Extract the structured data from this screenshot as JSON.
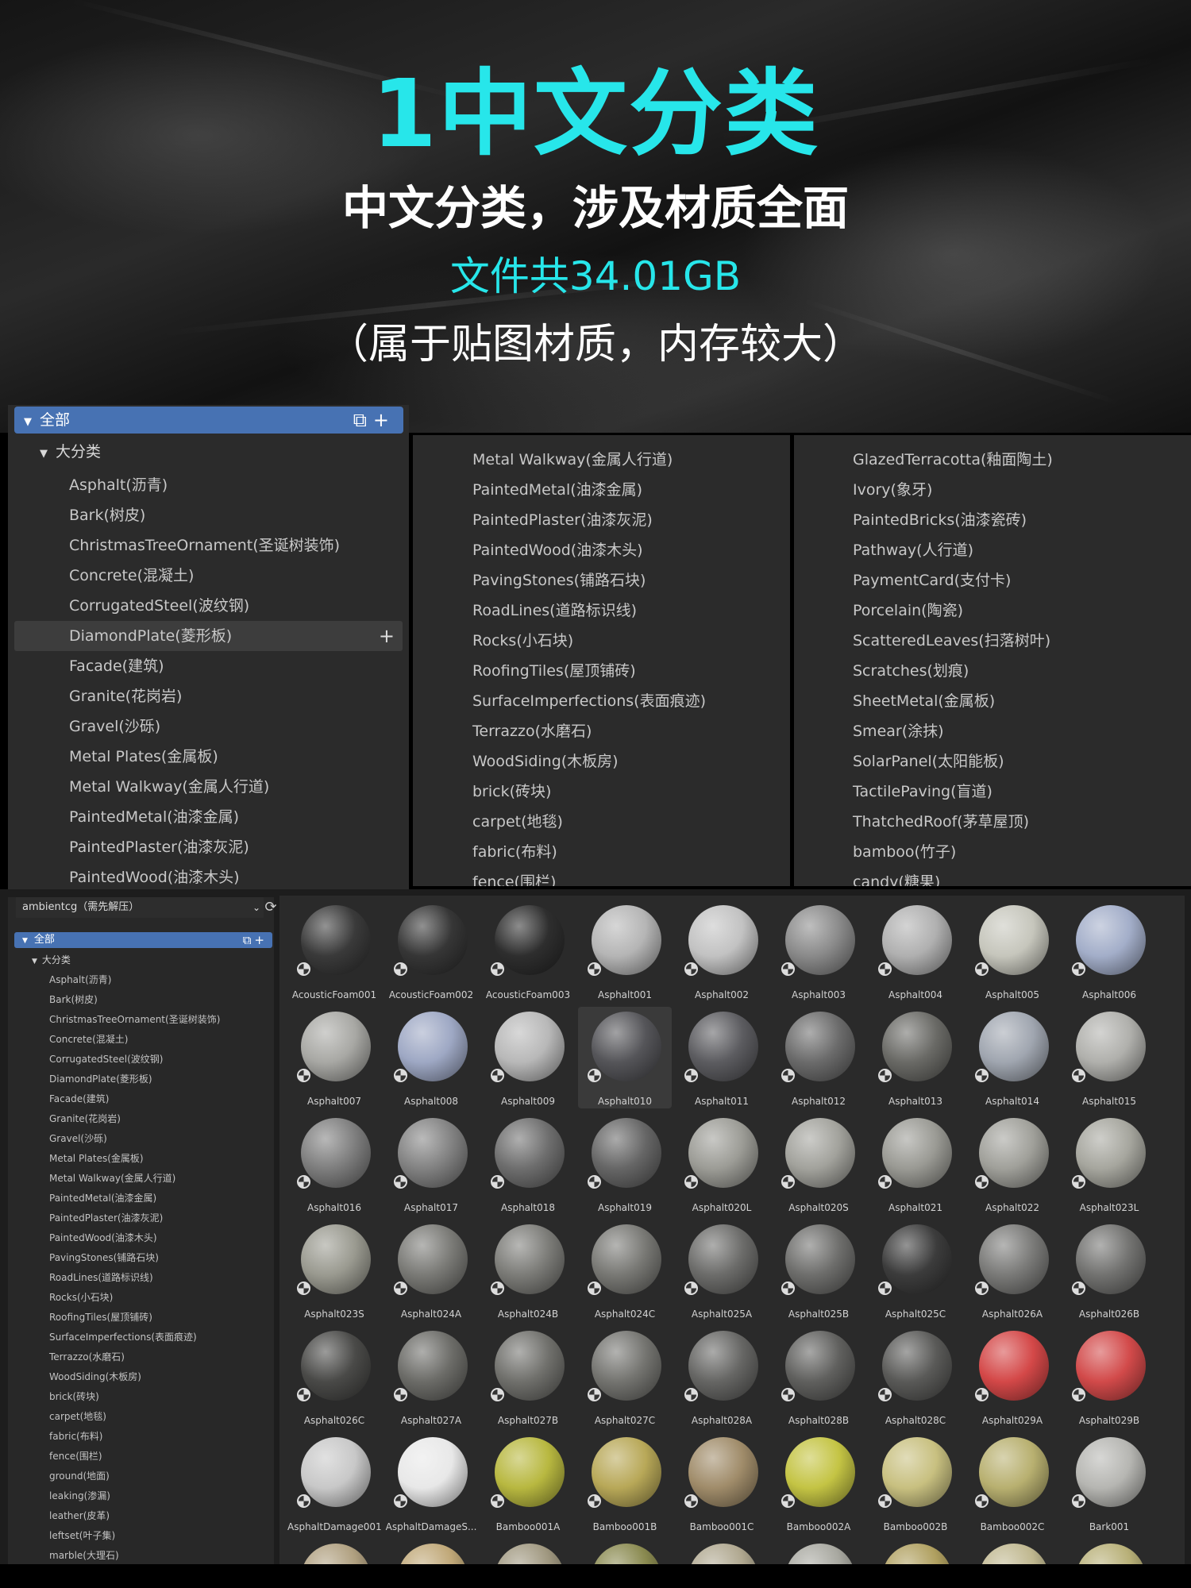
{
  "banner": {
    "title": "1中文分类",
    "subtitle": "中文分类，涉及材质全面",
    "size": "文件共34.01GB",
    "note": "（属于贴图材质，内存较大）"
  },
  "big_tree": {
    "root_label": "全部",
    "sub_label": "大分类",
    "col1": [
      "Asphalt(沥青)",
      "Bark(树皮)",
      "ChristmasTreeOrnament(圣诞树装饰)",
      "Concrete(混凝土)",
      "CorrugatedSteel(波纹钢)",
      "DiamondPlate(菱形板)",
      "Facade(建筑)",
      "Granite(花岗岩)",
      "Gravel(沙砾)",
      "Metal Plates(金属板)",
      "Metal Walkway(金属人行道)",
      "PaintedMetal(油漆金属)",
      "PaintedPlaster(油漆灰泥)",
      "PaintedWood(油漆木头)"
    ],
    "col2": [
      "Metal Walkway(金属人行道)",
      "PaintedMetal(油漆金属)",
      "PaintedPlaster(油漆灰泥)",
      "PaintedWood(油漆木头)",
      "PavingStones(铺路石块)",
      "RoadLines(道路标识线)",
      "Rocks(小石块)",
      "RoofingTiles(屋顶铺砖)",
      "SurfaceImperfections(表面痕迹)",
      "Terrazzo(水磨石)",
      "WoodSiding(木板房)",
      "brick(砖块)",
      "carpet(地毯)",
      "fabric(布料)",
      "fence(围栏)"
    ],
    "col3": [
      "GlazedTerracotta(釉面陶土)",
      "Ivory(象牙)",
      "PaintedBricks(油漆瓷砖)",
      "Pathway(人行道)",
      "PaymentCard(支付卡)",
      "Porcelain(陶瓷)",
      "ScatteredLeaves(扫落树叶)",
      "Scratches(划痕)",
      "SheetMetal(金属板)",
      "Smear(涂抹)",
      "SolarPanel(太阳能板)",
      "TactilePaving(盲道)",
      "ThatchedRoof(茅草屋顶)",
      "bamboo(竹子)",
      "candy(糖果)"
    ]
  },
  "browser": {
    "library": "ambientcg（需先解压）",
    "root_label": "全部",
    "sub_label": "大分类",
    "categories": [
      "Asphalt(沥青)",
      "Bark(树皮)",
      "ChristmasTreeOrnament(圣诞树装饰)",
      "Concrete(混凝土)",
      "CorrugatedSteel(波纹钢)",
      "DiamondPlate(菱形板)",
      "Facade(建筑)",
      "Granite(花岗岩)",
      "Gravel(沙砾)",
      "Metal Plates(金属板)",
      "Metal Walkway(金属人行道)",
      "PaintedMetal(油漆金属)",
      "PaintedPlaster(油漆灰泥)",
      "PaintedWood(油漆木头)",
      "PavingStones(铺路石块)",
      "RoadLines(道路标识线)",
      "Rocks(小石块)",
      "RoofingTiles(屋顶铺砖)",
      "SurfaceImperfections(表面痕迹)",
      "Terrazzo(水磨石)",
      "WoodSiding(木板房)",
      "brick(砖块)",
      "carpet(地毯)",
      "fabric(布料)",
      "fence(围栏)",
      "ground(地面)",
      "leaking(渗漏)",
      "leather(皮革)",
      "leftset(叶子集)",
      "marble(大理石)"
    ],
    "assets": [
      {
        "name": "AcousticFoam001",
        "color": "#3a3a3a"
      },
      {
        "name": "AcousticFoam002",
        "color": "#363636"
      },
      {
        "name": "AcousticFoam003",
        "color": "#2e2e2e"
      },
      {
        "name": "Asphalt001",
        "color": "#b5b5b5"
      },
      {
        "name": "Asphalt002",
        "color": "#c2c2c2"
      },
      {
        "name": "Asphalt003",
        "color": "#8a8a8a"
      },
      {
        "name": "Asphalt004",
        "color": "#b0b0b0"
      },
      {
        "name": "Asphalt005",
        "color": "#c6c6bc"
      },
      {
        "name": "Asphalt006",
        "color": "#a3aec9"
      },
      {
        "name": "Asphalt007",
        "color": "#a8a8a4"
      },
      {
        "name": "Asphalt008",
        "color": "#9ea8c4"
      },
      {
        "name": "Asphalt009",
        "color": "#b8b8b8"
      },
      {
        "name": "Asphalt010",
        "color": "#555559"
      },
      {
        "name": "Asphalt011",
        "color": "#5c5c60"
      },
      {
        "name": "Asphalt012",
        "color": "#6b6b6b"
      },
      {
        "name": "Asphalt013",
        "color": "#6a6a66"
      },
      {
        "name": "Asphalt014",
        "color": "#a0a6b0"
      },
      {
        "name": "Asphalt015",
        "color": "#b0b0ac"
      },
      {
        "name": "Asphalt016",
        "color": "#7e7e7e"
      },
      {
        "name": "Asphalt017",
        "color": "#828282"
      },
      {
        "name": "Asphalt018",
        "color": "#6e6e6e"
      },
      {
        "name": "Asphalt019",
        "color": "#666666"
      },
      {
        "name": "Asphalt020L",
        "color": "#9c9c96"
      },
      {
        "name": "Asphalt020S",
        "color": "#a2a29c"
      },
      {
        "name": "Asphalt021",
        "color": "#9a9a94"
      },
      {
        "name": "Asphalt022",
        "color": "#a0a09a"
      },
      {
        "name": "Asphalt023L",
        "color": "#a6a69e"
      },
      {
        "name": "Asphalt023S",
        "color": "#9a9a90"
      },
      {
        "name": "Asphalt024A",
        "color": "#7a7a76"
      },
      {
        "name": "Asphalt024B",
        "color": "#7c7c78"
      },
      {
        "name": "Asphalt024C",
        "color": "#787874"
      },
      {
        "name": "Asphalt025A",
        "color": "#6c6c6a"
      },
      {
        "name": "Asphalt025B",
        "color": "#6e6e6c"
      },
      {
        "name": "Asphalt025C",
        "color": "#3c3c3c"
      },
      {
        "name": "Asphalt026A",
        "color": "#7a7a78"
      },
      {
        "name": "Asphalt026B",
        "color": "#727270"
      },
      {
        "name": "Asphalt026C",
        "color": "#4a4a48"
      },
      {
        "name": "Asphalt027A",
        "color": "#6c6c68"
      },
      {
        "name": "Asphalt027B",
        "color": "#70706c"
      },
      {
        "name": "Asphalt027C",
        "color": "#747470"
      },
      {
        "name": "Asphalt028A",
        "color": "#666664"
      },
      {
        "name": "Asphalt028B",
        "color": "#60605e"
      },
      {
        "name": "Asphalt028C",
        "color": "#5a5a58"
      },
      {
        "name": "Asphalt029A",
        "color": "#d44848"
      },
      {
        "name": "Asphalt029B",
        "color": "#d24a4a"
      },
      {
        "name": "AsphaltDamage001",
        "color": "#c8c8c8"
      },
      {
        "name": "AsphaltDamageS...",
        "color": "#e8e8e8"
      },
      {
        "name": "Bamboo001A",
        "color": "#b8b840"
      },
      {
        "name": "Bamboo001B",
        "color": "#b8a858"
      },
      {
        "name": "Bamboo001C",
        "color": "#a08c6a"
      },
      {
        "name": "Bamboo002A",
        "color": "#c4c444"
      },
      {
        "name": "Bamboo002B",
        "color": "#c8c080"
      },
      {
        "name": "Bamboo002C",
        "color": "#b8b070"
      },
      {
        "name": "Bark001",
        "color": "#b6b6b2"
      },
      {
        "name": "",
        "color": "#b0a080"
      },
      {
        "name": "",
        "color": "#c0a878"
      },
      {
        "name": "",
        "color": "#a09880"
      },
      {
        "name": "",
        "color": "#8a8a50"
      },
      {
        "name": "",
        "color": "#b0a890"
      },
      {
        "name": "",
        "color": "#a8a8a0"
      },
      {
        "name": "",
        "color": "#b0a060"
      },
      {
        "name": "",
        "color": "#c0b890"
      },
      {
        "name": "",
        "color": "#b8b078"
      }
    ]
  }
}
